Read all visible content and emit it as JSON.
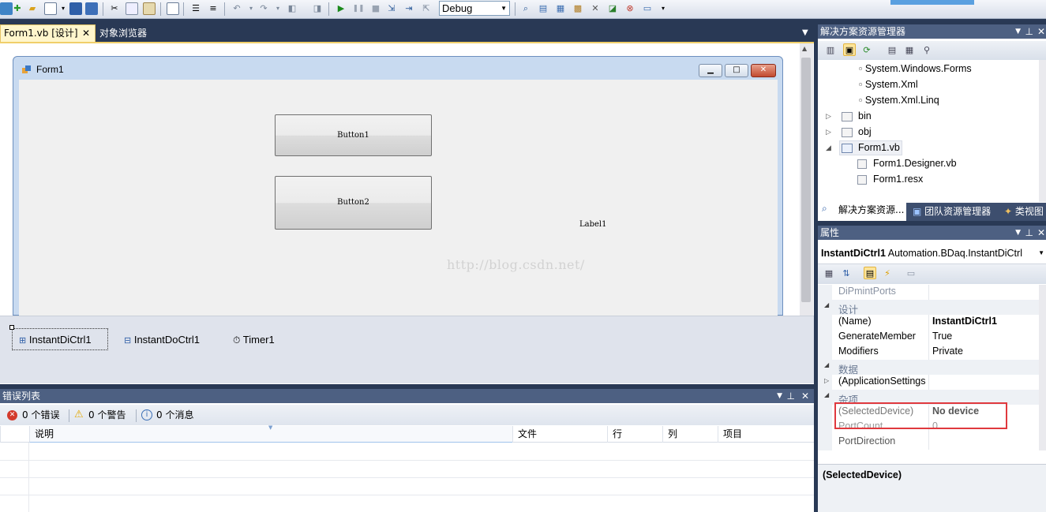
{
  "toolbar": {
    "config_select": "Debug",
    "icons": [
      "add-item-icon",
      "open-icon",
      "save-icon",
      "save-all-icon",
      "cut-icon",
      "copy-icon",
      "paste-icon",
      "find-icon",
      "comment-icon",
      "uncomment-icon",
      "undo-icon",
      "redo-icon",
      "navigate-back-icon",
      "navigate-forward-icon",
      "start-debug-icon",
      "pause-icon",
      "stop-icon",
      "step-into-icon",
      "step-over-icon",
      "step-out-icon",
      "find-in-files-icon",
      "solution-explorer-icon",
      "properties-icon",
      "object-browser-icon",
      "toolbox-icon",
      "extension-manager-icon",
      "error-list-icon",
      "command-window-icon"
    ]
  },
  "doc_tabs": {
    "active": "Form1.vb [设计]",
    "other": "对象浏览器"
  },
  "designer": {
    "form_title": "Form1",
    "button1": "Button1",
    "button2": "Button2",
    "label1": "Label1",
    "watermark": "http://blog.csdn.net/"
  },
  "tray": {
    "items": [
      "InstantDiCtrl1",
      "InstantDoCtrl1",
      "Timer1"
    ]
  },
  "error_list": {
    "title": "错误列表",
    "errors": "0 个错误",
    "warnings": "0 个警告",
    "messages": "0 个消息",
    "columns": [
      "说明",
      "文件",
      "行",
      "列",
      "项目"
    ]
  },
  "solution_explorer": {
    "title": "解决方案资源管理器",
    "items": [
      {
        "label": "System.Windows.Forms",
        "kind": "reference"
      },
      {
        "label": "System.Xml",
        "kind": "reference"
      },
      {
        "label": "System.Xml.Linq",
        "kind": "reference"
      },
      {
        "label": "bin",
        "kind": "folder",
        "expander": "▷"
      },
      {
        "label": "obj",
        "kind": "folder",
        "expander": "▷"
      },
      {
        "label": "Form1.vb",
        "kind": "form",
        "expander": "◢"
      },
      {
        "label": "Form1.Designer.vb",
        "kind": "vbfile"
      },
      {
        "label": "Form1.resx",
        "kind": "resx"
      }
    ],
    "tabs": [
      "解决方案资源...",
      "团队资源管理器",
      "类视图"
    ]
  },
  "properties": {
    "title": "属性",
    "object_name": "InstantDiCtrl1",
    "object_type": "Automation.BDaq.InstantDiCtrl",
    "rows": [
      {
        "type": "prop",
        "name": "DiPmintPorts",
        "value": "",
        "dim": true
      },
      {
        "type": "cat",
        "name": "设计",
        "expander": "◢"
      },
      {
        "type": "prop",
        "name": "(Name)",
        "value": "InstantDiCtrl1",
        "bold": true
      },
      {
        "type": "prop",
        "name": "GenerateMember",
        "value": "True"
      },
      {
        "type": "prop",
        "name": "Modifiers",
        "value": "Private"
      },
      {
        "type": "cat",
        "name": "数据",
        "expander": "◢"
      },
      {
        "type": "prop",
        "name": "(ApplicationSettings",
        "value": "",
        "expander": "▷"
      },
      {
        "type": "cat",
        "name": "杂项",
        "expander": "◢"
      },
      {
        "type": "prop",
        "name": "(SelectedDevice)",
        "value": "No device",
        "bold": true,
        "dim": true
      },
      {
        "type": "prop",
        "name": "PortCount",
        "value": "0",
        "dim": true
      },
      {
        "type": "prop",
        "name": "PortDirection",
        "value": "",
        "dim": true
      }
    ],
    "description_title": "(SelectedDevice)"
  }
}
